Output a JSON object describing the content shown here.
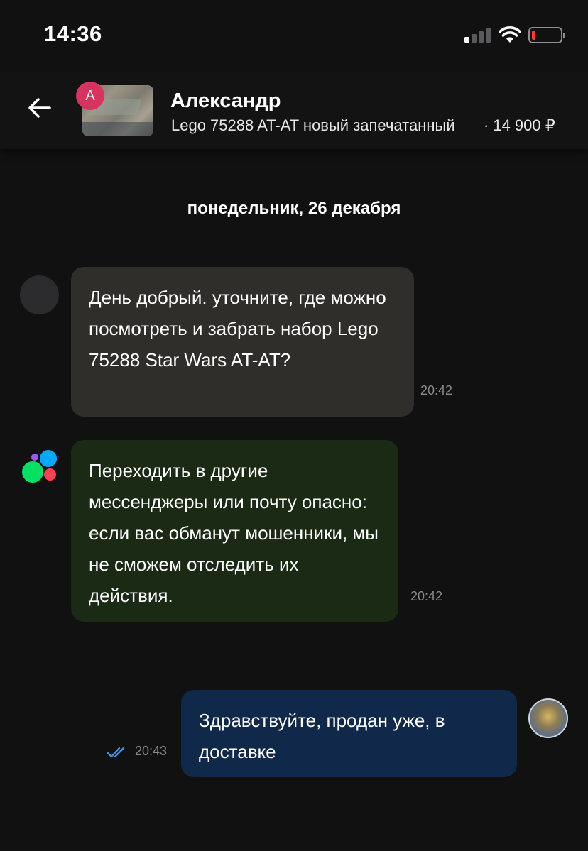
{
  "status_bar": {
    "time": "14:36"
  },
  "header": {
    "avatar_letter": "А",
    "contact_name": "Александр",
    "listing_title": "Lego 75288 AT-AT новый запечатанный",
    "separator": "·",
    "listing_price": "14 900 ₽"
  },
  "date_separator": "понедельник, 26 декабря",
  "messages": [
    {
      "text": "День добрый. уточните, где можно посмотреть и забрать набор Lego 75288 Star Wars AT-AT?",
      "time": "20:42"
    },
    {
      "text": "Переходить в другие мессенджеры или почту опасно: если вас обманут мошенники, мы не сможем отследить их действия.",
      "time": "20:42"
    },
    {
      "text": "Здравствуйте, продан уже, в доставке",
      "time": "20:43"
    }
  ],
  "colors": {
    "background": "#111111",
    "incoming_bubble": "#2f2e2b",
    "system_bubble": "#1a2a15",
    "outgoing_bubble": "#10294a",
    "read_check": "#4a90e2"
  }
}
